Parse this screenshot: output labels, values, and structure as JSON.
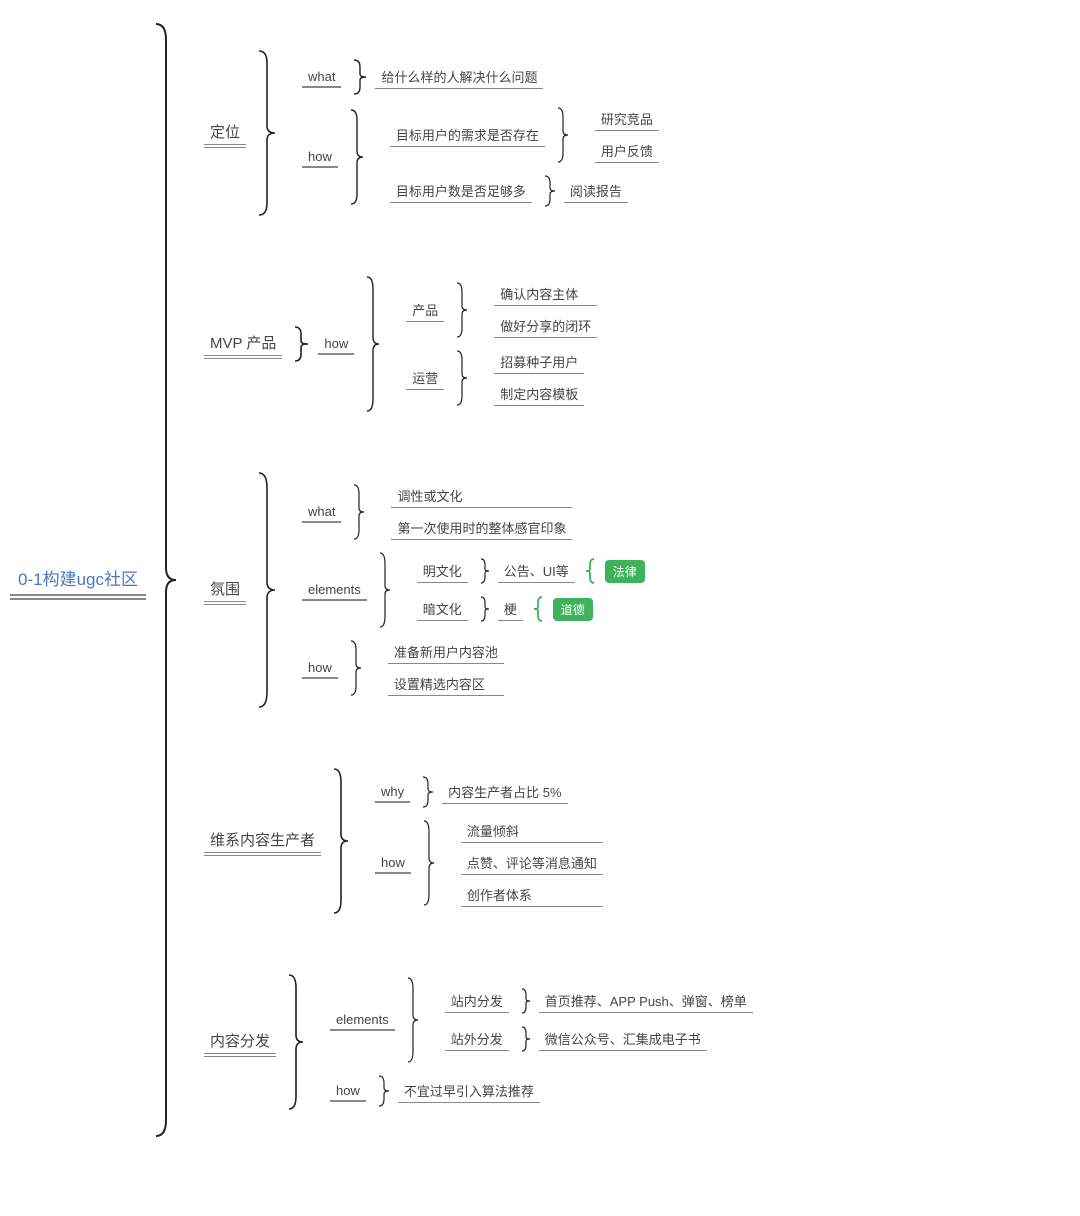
{
  "root": "0-1构建ugc社区",
  "b1": {
    "title": "定位",
    "what": "what",
    "what1": "给什么样的人解决什么问题",
    "how": "how",
    "h1": "目标用户的需求是否存在",
    "h1a": "研究竞品",
    "h1b": "用户反馈",
    "h2": "目标用户数是否足够多",
    "h2a": "阅读报告"
  },
  "b2": {
    "title": "MVP 产品",
    "how": "how",
    "p": "产品",
    "p1": "确认内容主体",
    "p2": "做好分享的闭环",
    "o": "运营",
    "o1": "招募种子用户",
    "o2": "制定内容模板"
  },
  "b3": {
    "title": "氛围",
    "what": "what",
    "w1": "调性或文化",
    "w2": "第一次使用时的整体感官印象",
    "el": "elements",
    "m": "明文化",
    "m1": "公告、UI等",
    "mlaw": "法律",
    "d": "暗文化",
    "d1": "梗",
    "dlaw": "道德",
    "how": "how",
    "h1": "准备新用户内容池",
    "h2": "设置精选内容区"
  },
  "b4": {
    "title": "维系内容生产者",
    "why": "why",
    "y1": "内容生产者占比 5%",
    "how": "how",
    "h1": "流量倾斜",
    "h2": "点赞、评论等消息通知",
    "h3": "创作者体系"
  },
  "b5": {
    "title": "内容分发",
    "el": "elements",
    "in": "站内分发",
    "in1": "首页推荐、APP Push、弹窗、榜单",
    "out": "站外分发",
    "out1": "微信公众号、汇集成电子书",
    "how": "how",
    "h1": "不宜过早引入算法推荐"
  }
}
